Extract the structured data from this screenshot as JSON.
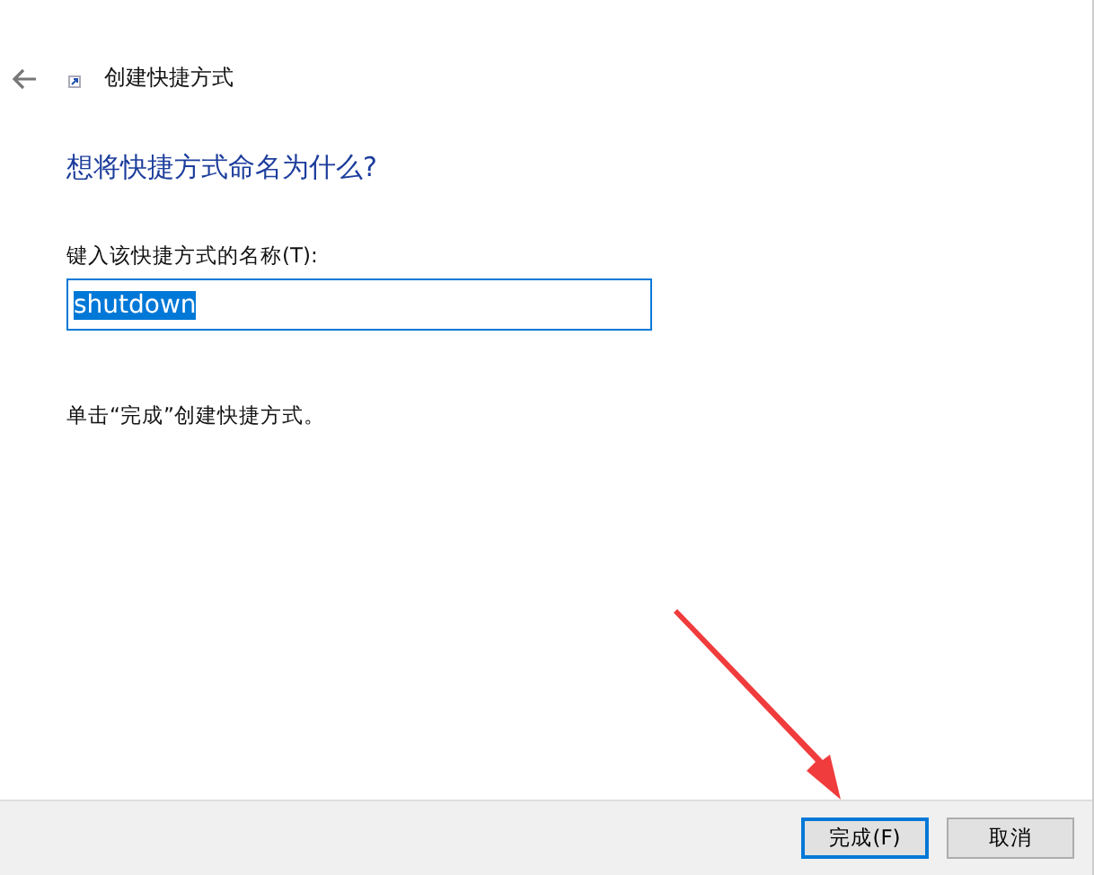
{
  "window": {
    "title": "创建快捷方式"
  },
  "heading": "想将快捷方式命名为什么?",
  "name_field": {
    "label": "键入该快捷方式的名称(T):",
    "value": "shutdown",
    "text_selected": true
  },
  "instruction": "单击“完成”创建快捷方式。",
  "buttons": [
    {
      "label": "完成(F)",
      "selected": true
    },
    {
      "label": "取消",
      "selected": false
    }
  ],
  "annotation": {
    "kind": "arrow"
  }
}
